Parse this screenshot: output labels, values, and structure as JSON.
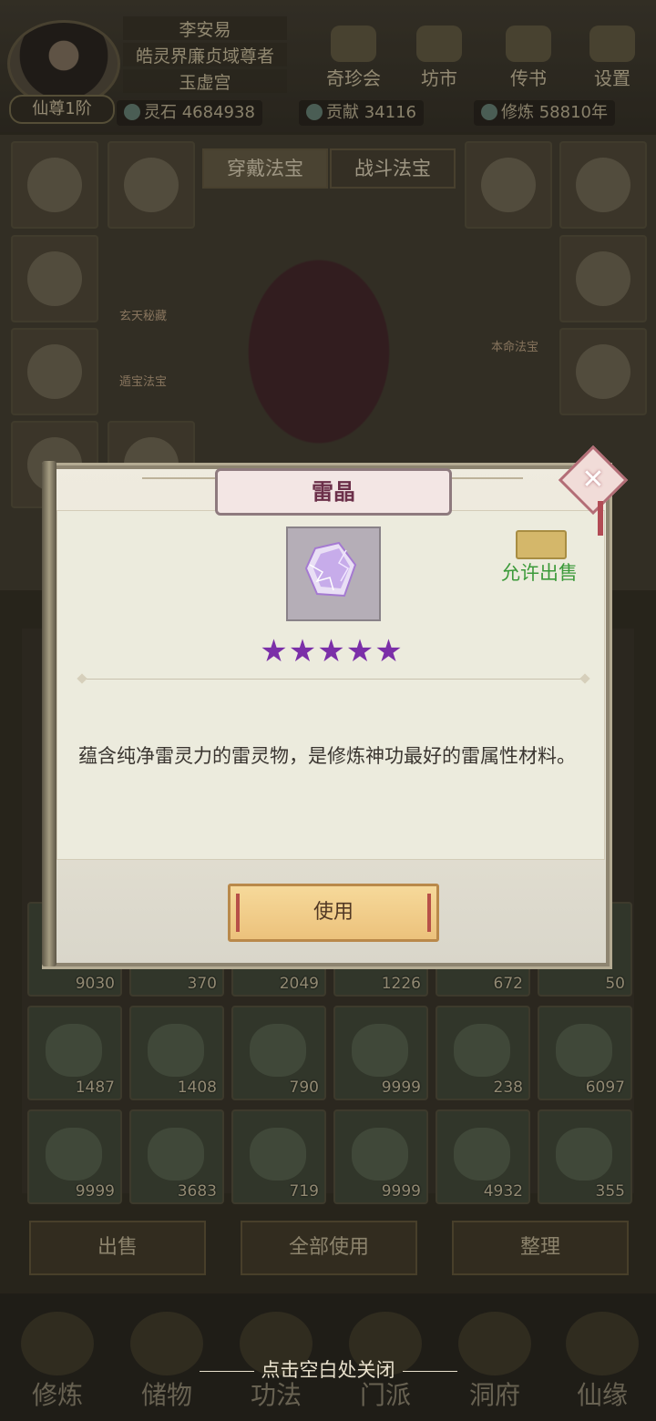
{
  "player": {
    "name": "李安易",
    "title": "皓灵界廉贞域尊者",
    "sect": "玉虚宫",
    "rank": "仙尊1阶"
  },
  "top_menu": [
    "奇珍会",
    "坊市",
    "传书",
    "设置"
  ],
  "resources": [
    {
      "label": "灵石",
      "value": "4684938"
    },
    {
      "label": "贡献",
      "value": "34116"
    },
    {
      "label": "修炼",
      "value": "58810年"
    }
  ],
  "equip_tabs": [
    "穿戴法宝",
    "战斗法宝"
  ],
  "equip_side_labels": [
    "玄天秘藏",
    "遁宝法宝",
    "本命法宝"
  ],
  "inventory_counts": [
    "9030",
    "370",
    "2049",
    "1226",
    "672",
    "50",
    "1487",
    "1408",
    "790",
    "9999",
    "238",
    "6097",
    "9999",
    "3683",
    "719",
    "9999",
    "4932",
    "355"
  ],
  "bottom_buttons": [
    "出售",
    "全部使用",
    "整理"
  ],
  "bottom_nav": [
    "修炼",
    "储物",
    "功法",
    "门派",
    "洞府",
    "仙缘"
  ],
  "close_hint": "点击空白处关闭",
  "item_modal": {
    "title": "雷晶",
    "stars": 5,
    "star_text": "★★★★★",
    "sell_status": "允许出售",
    "description": "蕴含纯净雷灵力的雷灵物，是修炼神功最好的雷属性材料。",
    "use_label": "使用",
    "close_glyph": "✕"
  },
  "colors": {
    "star": "#7b2fa8",
    "sell_text": "#3c9a3a",
    "title_text": "#6b2f49"
  }
}
